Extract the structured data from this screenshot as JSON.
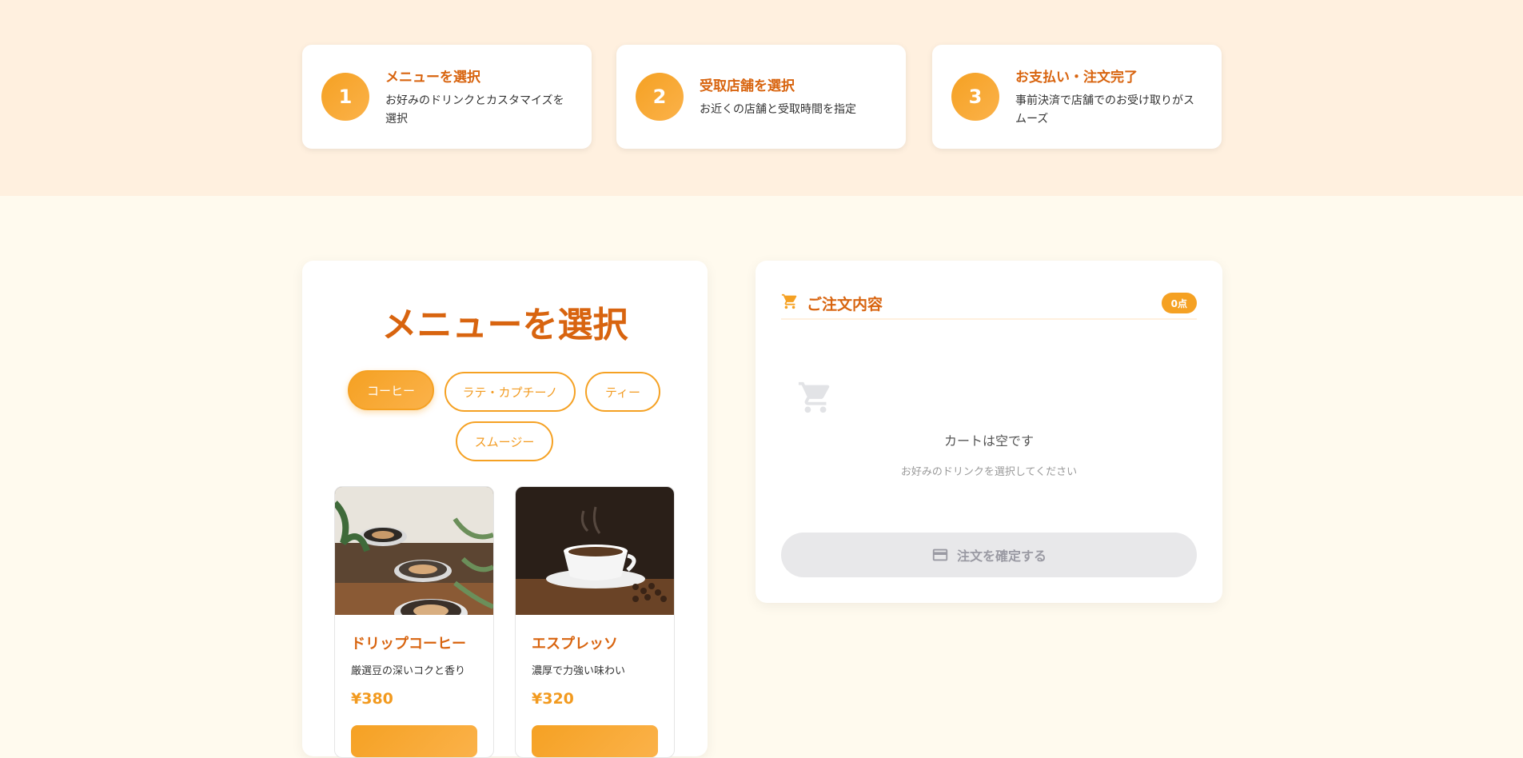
{
  "steps": [
    {
      "number": "1",
      "title": "メニューを選択",
      "desc": "お好みのドリンクとカスタマイズを選択"
    },
    {
      "number": "2",
      "title": "受取店舗を選択",
      "desc": "お近くの店舗と受取時間を指定"
    },
    {
      "number": "3",
      "title": "お支払い・注文完了",
      "desc": "事前決済で店舗でのお受け取りがスムーズ"
    }
  ],
  "menu": {
    "title": "メニューを選択",
    "categories": [
      "コーヒー",
      "ラテ・カプチーノ",
      "ティー",
      "スムージー"
    ],
    "active_category": "コーヒー",
    "products": [
      {
        "name": "ドリップコーヒー",
        "desc": "厳選豆の深いコクと香り",
        "price": "¥380"
      },
      {
        "name": "エスプレッソ",
        "desc": "濃厚で力強い味わい",
        "price": "¥320"
      }
    ]
  },
  "cart": {
    "title": "ご注文内容",
    "count": "0点",
    "empty_title": "カートは空です",
    "empty_sub": "お好みのドリンクを選択してください",
    "confirm_label": "注文を確定する"
  },
  "icons": {
    "cart_header": "shopping-cart-icon",
    "cart_empty": "shopping-cart-icon",
    "confirm": "credit-card-icon"
  },
  "colors": {
    "accent": "#f5a123",
    "title": "#d8640f",
    "band": "#fff0df",
    "page_bg": "#fffaee",
    "disabled": "#e8e8ea"
  }
}
